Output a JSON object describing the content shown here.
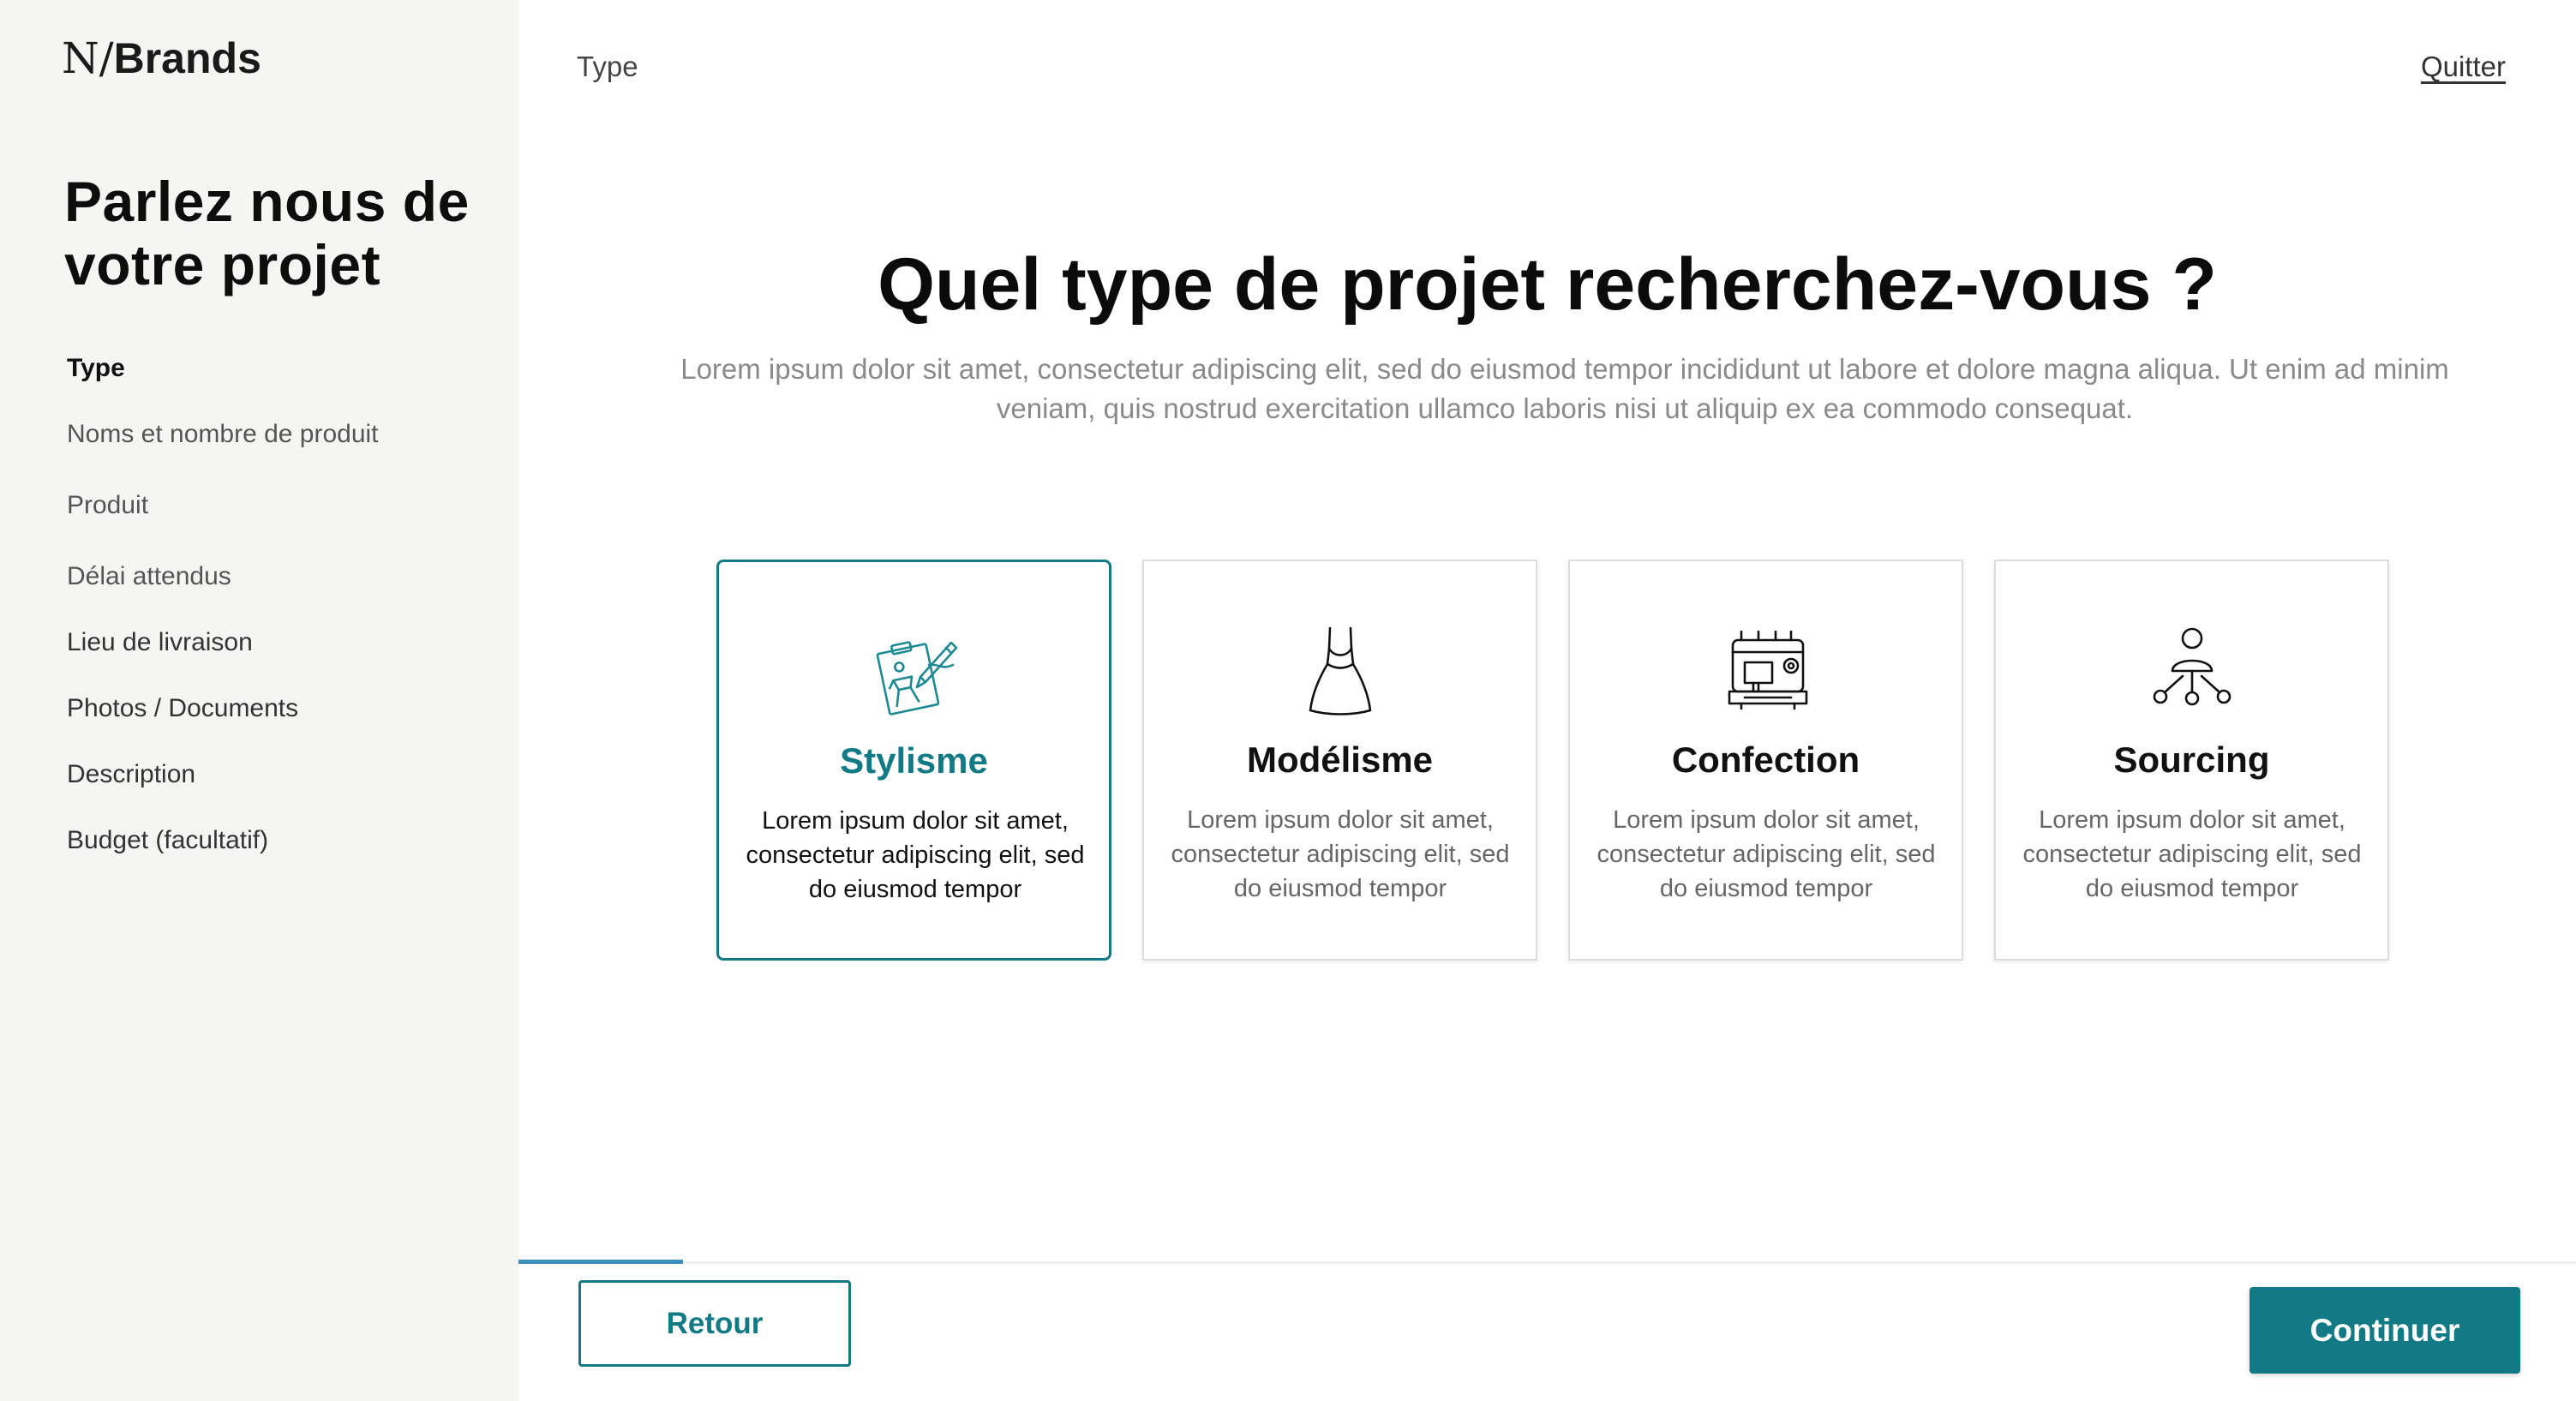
{
  "brand": {
    "mark": "N",
    "separator": "/",
    "word": "Brands"
  },
  "sidebar": {
    "title": "Parlez nous de votre projet",
    "steps": [
      {
        "label": "Type",
        "state": "active"
      },
      {
        "label": "Noms et nombre de produit",
        "state": "muted"
      },
      {
        "label": "Produit",
        "state": "muted"
      },
      {
        "label": "Délai attendus",
        "state": "muted"
      },
      {
        "label": "Lieu de livraison",
        "state": "normal"
      },
      {
        "label": "Photos / Documents",
        "state": "normal"
      },
      {
        "label": "Description",
        "state": "normal"
      },
      {
        "label": "Budget (facultatif)",
        "state": "normal"
      }
    ]
  },
  "header": {
    "breadcrumb": "Type",
    "quit_label": "Quitter"
  },
  "main": {
    "title": "Quel type de projet recherchez-vous ?",
    "subtitle": "Lorem ipsum dolor sit amet, consectetur adipiscing elit, sed do eiusmod tempor incididunt ut labore et dolore magna aliqua. Ut enim ad minim veniam, quis nostrud exercitation ullamco laboris nisi ut aliquip ex ea commodo consequat.",
    "cards": [
      {
        "title": "Stylisme",
        "description": "Lorem ipsum dolor sit amet, consectetur adipiscing elit, sed do eiusmod tempor",
        "icon": "fashion-sketch-icon",
        "selected": true
      },
      {
        "title": "Modélisme",
        "description": "Lorem ipsum dolor sit amet, consectetur adipiscing elit, sed do eiusmod tempor",
        "icon": "dress-icon",
        "selected": false
      },
      {
        "title": "Confection",
        "description": "Lorem ipsum dolor sit amet, consectetur adipiscing elit, sed do eiusmod tempor",
        "icon": "sewing-machine-icon",
        "selected": false
      },
      {
        "title": "Sourcing",
        "description": "Lorem ipsum dolor sit amet, consectetur adipiscing elit, sed do eiusmod tempor",
        "icon": "sourcing-network-icon",
        "selected": false
      }
    ]
  },
  "footer": {
    "back_label": "Retour",
    "continue_label": "Continuer",
    "progress_fraction": 0.08
  },
  "colors": {
    "accent": "#127a85",
    "progress": "#3b8fbd",
    "sidebar_bg": "#f5f5f4",
    "icon_teal": "#1d8a93"
  }
}
